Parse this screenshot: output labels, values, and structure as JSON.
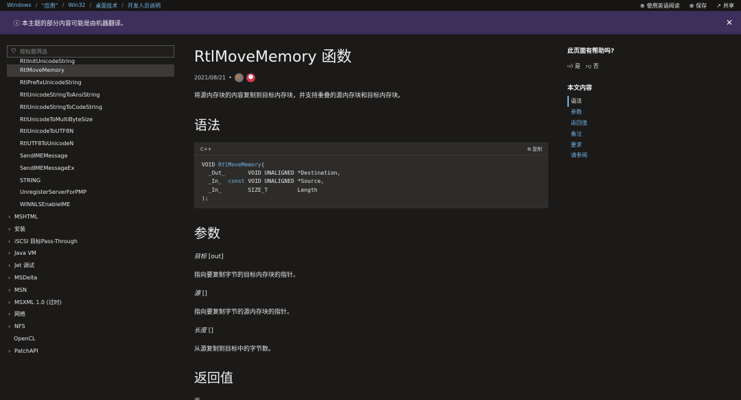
{
  "breadcrumb": [
    "Windows",
    "“应用”",
    "Win32",
    "桌面技术",
    "开发人员说明"
  ],
  "actions": {
    "read_english": "使用英语阅读",
    "save": "保存",
    "share": "共享"
  },
  "banner": {
    "text": "本主题的部分内容可能是由机器翻译。",
    "close": "✕"
  },
  "sidebar": {
    "filter_placeholder": "按标题筛选",
    "cut_item": "RtlInitUnicodeString",
    "items": [
      {
        "label": "RtlMoveMemory"
      },
      {
        "label": "RtlPrefixUnicodeString"
      },
      {
        "label": "RtlUnicodeStringToAnsiString"
      },
      {
        "label": "RtlUnicodeStringToCodeString"
      },
      {
        "label": "RtlUnicodeToMultiByteSize"
      },
      {
        "label": "RtlUnicodeToUTF8N"
      },
      {
        "label": "RtlUTF8ToUnicodeN"
      },
      {
        "label": "SendIMEMessage"
      },
      {
        "label": "SendIMEMessageEx"
      },
      {
        "label": "STRING"
      },
      {
        "label": "UnregisterServerForPMP"
      },
      {
        "label": "WINNLSEnableIME"
      }
    ],
    "groups": [
      {
        "label": "MSHTML"
      },
      {
        "label": "安装"
      },
      {
        "label": "iSCSI 目标Pass-Through"
      },
      {
        "label": "Java VM"
      },
      {
        "label": "Jet 调试"
      },
      {
        "label": "MSDelta"
      },
      {
        "label": "MSN"
      },
      {
        "label": "MSXML 1.0 (过时)"
      },
      {
        "label": "网络"
      },
      {
        "label": "NFS"
      }
    ],
    "plain_item": "OpenCL",
    "last_group": "PatchAPI"
  },
  "article": {
    "title": "RtlMoveMemory 函数",
    "date": "2021/08/21",
    "bullet": "•",
    "description": "将源内存块的内容复制到目标内存块，并支持重叠的源内存块和目标内存块。",
    "syntax_heading": "语法",
    "code": {
      "language": "C++",
      "copy_label": "复制",
      "line1_a": "VOID ",
      "line1_fn": "RtlMoveMemory",
      "line1_b": "(",
      "line2": "  _Out_       VOID UNALIGNED *Destination,",
      "line3_a": "  _In_  ",
      "line3_kw": "const",
      "line3_b": " VOID UNALIGNED *Source,",
      "line4": "  _In_        SIZE_T         Length",
      "line5": ");"
    },
    "params_heading": "参数",
    "params": [
      {
        "name": "目标",
        "tag": " [out]",
        "desc": "指向要复制字节的目标内存块的指针。"
      },
      {
        "name": "源",
        "tag": " []",
        "desc": "指向要复制字节的源内存块的指针。"
      },
      {
        "name": "长度",
        "tag": " []",
        "desc": "从源复制到目标中的字节数。"
      }
    ],
    "return_heading": "返回值",
    "return_text": "无"
  },
  "right_panel": {
    "helpful_title": "此页面有帮助吗?",
    "yes": "是",
    "no": "否",
    "toc_title": "本文内容",
    "toc": [
      "语法",
      "参数",
      "返回值",
      "备注",
      "要求",
      "请参阅"
    ]
  },
  "colors": {
    "accent": "#75b6e7",
    "banner": "#3c2f5c",
    "background": "#1b1a19"
  }
}
